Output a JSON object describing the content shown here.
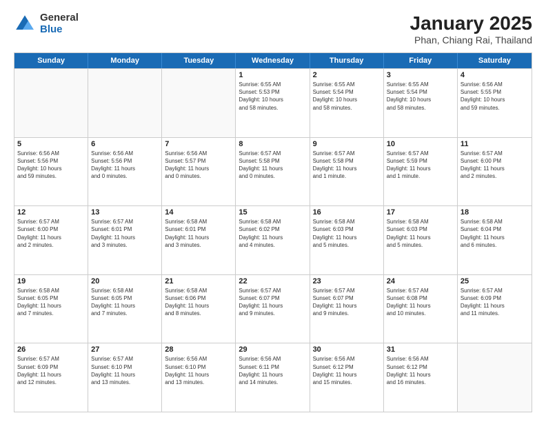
{
  "logo": {
    "general": "General",
    "blue": "Blue"
  },
  "title": "January 2025",
  "subtitle": "Phan, Chiang Rai, Thailand",
  "days": [
    "Sunday",
    "Monday",
    "Tuesday",
    "Wednesday",
    "Thursday",
    "Friday",
    "Saturday"
  ],
  "rows": [
    [
      {
        "day": "",
        "lines": [],
        "empty": true
      },
      {
        "day": "",
        "lines": [],
        "empty": true
      },
      {
        "day": "",
        "lines": [],
        "empty": true
      },
      {
        "day": "1",
        "lines": [
          "Sunrise: 6:55 AM",
          "Sunset: 5:53 PM",
          "Daylight: 10 hours",
          "and 58 minutes."
        ]
      },
      {
        "day": "2",
        "lines": [
          "Sunrise: 6:55 AM",
          "Sunset: 5:54 PM",
          "Daylight: 10 hours",
          "and 58 minutes."
        ]
      },
      {
        "day": "3",
        "lines": [
          "Sunrise: 6:55 AM",
          "Sunset: 5:54 PM",
          "Daylight: 10 hours",
          "and 58 minutes."
        ]
      },
      {
        "day": "4",
        "lines": [
          "Sunrise: 6:56 AM",
          "Sunset: 5:55 PM",
          "Daylight: 10 hours",
          "and 59 minutes."
        ]
      }
    ],
    [
      {
        "day": "5",
        "lines": [
          "Sunrise: 6:56 AM",
          "Sunset: 5:56 PM",
          "Daylight: 10 hours",
          "and 59 minutes."
        ]
      },
      {
        "day": "6",
        "lines": [
          "Sunrise: 6:56 AM",
          "Sunset: 5:56 PM",
          "Daylight: 11 hours",
          "and 0 minutes."
        ]
      },
      {
        "day": "7",
        "lines": [
          "Sunrise: 6:56 AM",
          "Sunset: 5:57 PM",
          "Daylight: 11 hours",
          "and 0 minutes."
        ]
      },
      {
        "day": "8",
        "lines": [
          "Sunrise: 6:57 AM",
          "Sunset: 5:58 PM",
          "Daylight: 11 hours",
          "and 0 minutes."
        ]
      },
      {
        "day": "9",
        "lines": [
          "Sunrise: 6:57 AM",
          "Sunset: 5:58 PM",
          "Daylight: 11 hours",
          "and 1 minute."
        ]
      },
      {
        "day": "10",
        "lines": [
          "Sunrise: 6:57 AM",
          "Sunset: 5:59 PM",
          "Daylight: 11 hours",
          "and 1 minute."
        ]
      },
      {
        "day": "11",
        "lines": [
          "Sunrise: 6:57 AM",
          "Sunset: 6:00 PM",
          "Daylight: 11 hours",
          "and 2 minutes."
        ]
      }
    ],
    [
      {
        "day": "12",
        "lines": [
          "Sunrise: 6:57 AM",
          "Sunset: 6:00 PM",
          "Daylight: 11 hours",
          "and 2 minutes."
        ]
      },
      {
        "day": "13",
        "lines": [
          "Sunrise: 6:57 AM",
          "Sunset: 6:01 PM",
          "Daylight: 11 hours",
          "and 3 minutes."
        ]
      },
      {
        "day": "14",
        "lines": [
          "Sunrise: 6:58 AM",
          "Sunset: 6:01 PM",
          "Daylight: 11 hours",
          "and 3 minutes."
        ]
      },
      {
        "day": "15",
        "lines": [
          "Sunrise: 6:58 AM",
          "Sunset: 6:02 PM",
          "Daylight: 11 hours",
          "and 4 minutes."
        ]
      },
      {
        "day": "16",
        "lines": [
          "Sunrise: 6:58 AM",
          "Sunset: 6:03 PM",
          "Daylight: 11 hours",
          "and 5 minutes."
        ]
      },
      {
        "day": "17",
        "lines": [
          "Sunrise: 6:58 AM",
          "Sunset: 6:03 PM",
          "Daylight: 11 hours",
          "and 5 minutes."
        ]
      },
      {
        "day": "18",
        "lines": [
          "Sunrise: 6:58 AM",
          "Sunset: 6:04 PM",
          "Daylight: 11 hours",
          "and 6 minutes."
        ]
      }
    ],
    [
      {
        "day": "19",
        "lines": [
          "Sunrise: 6:58 AM",
          "Sunset: 6:05 PM",
          "Daylight: 11 hours",
          "and 7 minutes."
        ]
      },
      {
        "day": "20",
        "lines": [
          "Sunrise: 6:58 AM",
          "Sunset: 6:05 PM",
          "Daylight: 11 hours",
          "and 7 minutes."
        ]
      },
      {
        "day": "21",
        "lines": [
          "Sunrise: 6:58 AM",
          "Sunset: 6:06 PM",
          "Daylight: 11 hours",
          "and 8 minutes."
        ]
      },
      {
        "day": "22",
        "lines": [
          "Sunrise: 6:57 AM",
          "Sunset: 6:07 PM",
          "Daylight: 11 hours",
          "and 9 minutes."
        ]
      },
      {
        "day": "23",
        "lines": [
          "Sunrise: 6:57 AM",
          "Sunset: 6:07 PM",
          "Daylight: 11 hours",
          "and 9 minutes."
        ]
      },
      {
        "day": "24",
        "lines": [
          "Sunrise: 6:57 AM",
          "Sunset: 6:08 PM",
          "Daylight: 11 hours",
          "and 10 minutes."
        ]
      },
      {
        "day": "25",
        "lines": [
          "Sunrise: 6:57 AM",
          "Sunset: 6:09 PM",
          "Daylight: 11 hours",
          "and 11 minutes."
        ]
      }
    ],
    [
      {
        "day": "26",
        "lines": [
          "Sunrise: 6:57 AM",
          "Sunset: 6:09 PM",
          "Daylight: 11 hours",
          "and 12 minutes."
        ]
      },
      {
        "day": "27",
        "lines": [
          "Sunrise: 6:57 AM",
          "Sunset: 6:10 PM",
          "Daylight: 11 hours",
          "and 13 minutes."
        ]
      },
      {
        "day": "28",
        "lines": [
          "Sunrise: 6:56 AM",
          "Sunset: 6:10 PM",
          "Daylight: 11 hours",
          "and 13 minutes."
        ]
      },
      {
        "day": "29",
        "lines": [
          "Sunrise: 6:56 AM",
          "Sunset: 6:11 PM",
          "Daylight: 11 hours",
          "and 14 minutes."
        ]
      },
      {
        "day": "30",
        "lines": [
          "Sunrise: 6:56 AM",
          "Sunset: 6:12 PM",
          "Daylight: 11 hours",
          "and 15 minutes."
        ]
      },
      {
        "day": "31",
        "lines": [
          "Sunrise: 6:56 AM",
          "Sunset: 6:12 PM",
          "Daylight: 11 hours",
          "and 16 minutes."
        ]
      },
      {
        "day": "",
        "lines": [],
        "empty": true
      }
    ]
  ]
}
